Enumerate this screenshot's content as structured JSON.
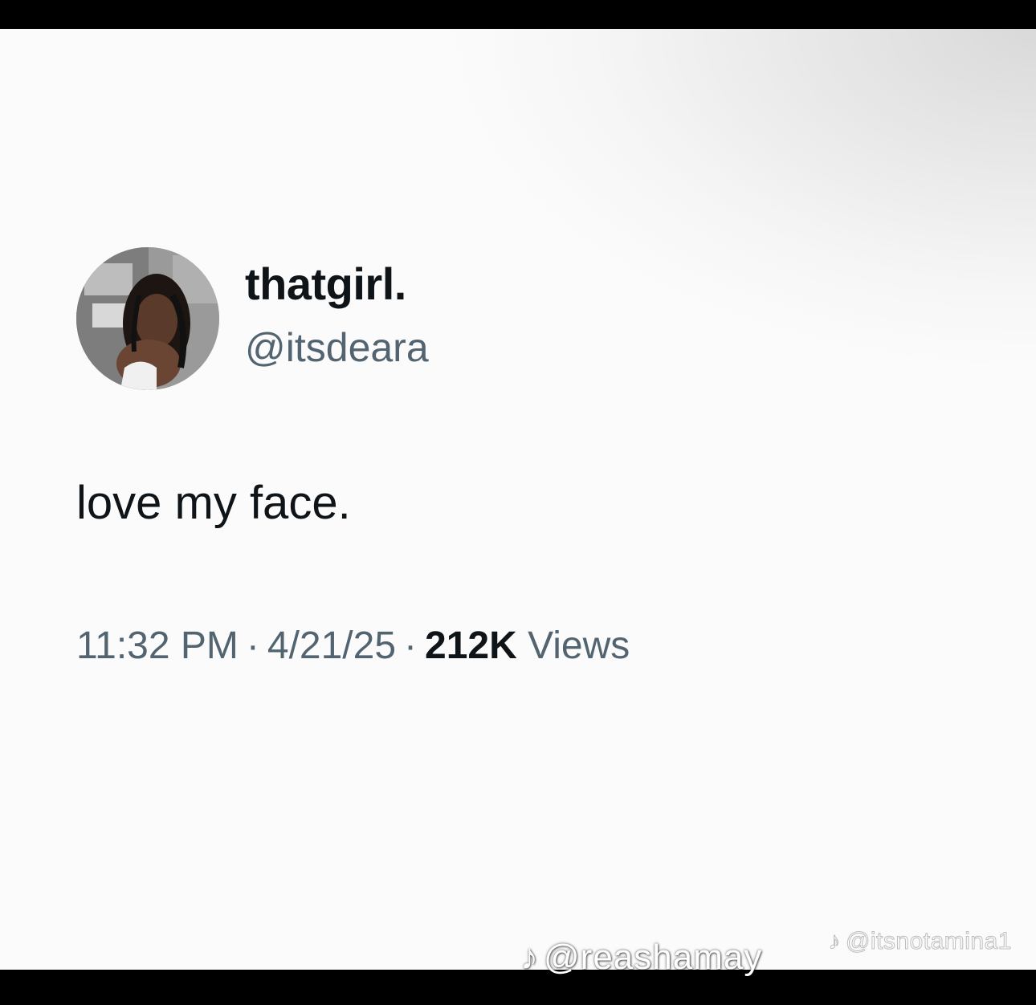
{
  "tweet": {
    "display_name": "thatgirl.",
    "handle": "@itsdeara",
    "text": "love my face.",
    "time": "11:32 PM",
    "separator": "·",
    "date": "4/21/25",
    "views_count": "212K",
    "views_label": "Views",
    "avatar_icon": "profile-photo"
  },
  "watermarks": {
    "secondary_icon": "tiktok-note-icon",
    "secondary_text": "@itsnotamina1",
    "primary_icon": "tiktok-note-icon",
    "primary_text": "@reashamay"
  },
  "colors": {
    "text_primary": "#0f1419",
    "text_secondary": "#536471",
    "background": "#fbfbfb",
    "letterbox": "#000000"
  }
}
